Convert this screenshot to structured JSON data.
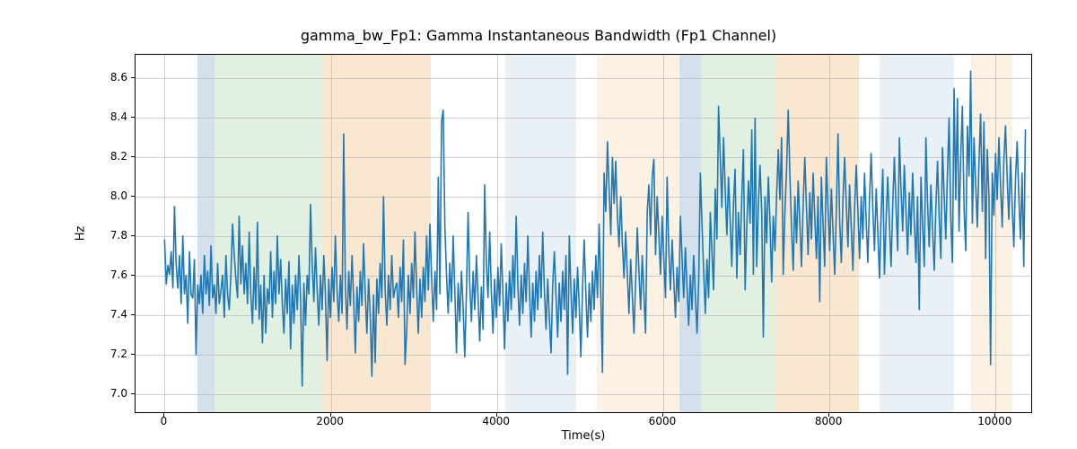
{
  "chart_data": {
    "type": "line",
    "title": "gamma_bw_Fp1: Gamma Instantaneous Bandwidth (Fp1 Channel)",
    "xlabel": "Time(s)",
    "ylabel": "Hz",
    "xlim": [
      -350,
      10450
    ],
    "ylim": [
      6.9,
      8.72
    ],
    "xticks": [
      0,
      2000,
      4000,
      6000,
      8000,
      10000
    ],
    "yticks": [
      7.0,
      7.2,
      7.4,
      7.6,
      7.8,
      8.0,
      8.2,
      8.4,
      8.6
    ],
    "grid": true,
    "bands": [
      {
        "x0": 400,
        "x1": 600,
        "color": "#b8cde0"
      },
      {
        "x0": 600,
        "x1": 1900,
        "color": "#cfe6cf"
      },
      {
        "x0": 1900,
        "x1": 3200,
        "color": "#f7d7b0"
      },
      {
        "x0": 4100,
        "x1": 4950,
        "color": "#dbe7f0"
      },
      {
        "x0": 5200,
        "x1": 6200,
        "color": "#fbe8d0"
      },
      {
        "x0": 6200,
        "x1": 6450,
        "color": "#b8cde0"
      },
      {
        "x0": 6450,
        "x1": 7350,
        "color": "#cfe6cf"
      },
      {
        "x0": 7350,
        "x1": 8350,
        "color": "#f7d7b0"
      },
      {
        "x0": 8600,
        "x1": 9500,
        "color": "#dbe7f0"
      },
      {
        "x0": 9700,
        "x1": 10200,
        "color": "#fbe8d0"
      }
    ],
    "series": [
      {
        "name": "gamma_bw_Fp1",
        "color": "#1f77b4",
        "x_start": 0,
        "x_step": 20,
        "y": [
          7.78,
          7.55,
          7.65,
          7.6,
          7.72,
          7.53,
          7.95,
          7.65,
          7.53,
          7.7,
          7.45,
          7.8,
          7.5,
          7.6,
          7.35,
          7.72,
          7.5,
          7.48,
          7.68,
          7.19,
          7.55,
          7.45,
          7.6,
          7.4,
          7.7,
          7.5,
          7.62,
          7.44,
          7.75,
          7.48,
          7.55,
          7.4,
          7.66,
          7.45,
          7.52,
          7.6,
          7.38,
          7.7,
          7.5,
          7.42,
          7.6,
          7.86,
          7.7,
          7.58,
          7.48,
          7.9,
          7.55,
          7.75,
          7.5,
          7.66,
          7.45,
          7.82,
          7.5,
          7.35,
          7.64,
          7.42,
          7.87,
          7.37,
          7.55,
          7.25,
          7.6,
          7.3,
          7.53,
          7.45,
          7.72,
          7.38,
          7.62,
          7.45,
          7.8,
          7.5,
          7.68,
          7.45,
          7.3,
          7.58,
          7.4,
          7.67,
          7.22,
          7.55,
          7.35,
          7.6,
          7.42,
          7.7,
          7.48,
          7.03,
          7.56,
          7.34,
          7.6,
          7.5,
          7.96,
          7.66,
          7.46,
          7.74,
          7.52,
          7.34,
          7.6,
          7.42,
          7.7,
          7.5,
          7.16,
          7.58,
          7.38,
          7.64,
          7.46,
          7.8,
          7.52,
          7.36,
          7.6,
          7.4,
          8.32,
          7.54,
          7.32,
          7.62,
          7.44,
          7.7,
          7.48,
          7.2,
          7.54,
          7.36,
          7.62,
          7.44,
          7.76,
          7.5,
          7.3,
          7.58,
          7.4,
          7.08,
          7.5,
          7.15,
          7.58,
          7.4,
          7.66,
          7.48,
          8.0,
          7.52,
          7.34,
          7.6,
          7.42,
          7.7,
          7.48,
          7.53,
          7.56,
          7.38,
          7.64,
          7.46,
          7.78,
          7.14,
          7.32,
          7.6,
          7.4,
          7.66,
          7.48,
          7.82,
          7.52,
          7.3,
          7.58,
          7.38,
          7.64,
          7.46,
          7.8,
          7.52,
          7.86,
          7.58,
          7.36,
          7.62,
          7.42,
          8.1,
          7.5,
          8.38,
          8.44,
          7.84,
          7.6,
          7.4,
          7.66,
          7.46,
          7.8,
          7.52,
          7.2,
          7.56,
          7.36,
          7.62,
          7.44,
          7.18,
          7.5,
          7.92,
          7.56,
          7.36,
          7.62,
          7.42,
          7.7,
          7.48,
          7.26,
          7.54,
          7.32,
          8.06,
          7.66,
          7.48,
          7.82,
          7.52,
          7.3,
          7.58,
          7.38,
          7.64,
          7.44,
          7.76,
          7.5,
          7.22,
          7.56,
          7.36,
          7.62,
          7.42,
          7.7,
          7.48,
          7.9,
          7.54,
          7.34,
          7.6,
          7.4,
          7.66,
          7.46,
          7.8,
          7.52,
          7.28,
          7.56,
          7.36,
          7.62,
          7.42,
          7.7,
          7.48,
          7.82,
          7.52,
          7.32,
          7.58,
          7.38,
          7.2,
          7.54,
          7.72,
          7.5,
          7.28,
          7.56,
          7.36,
          7.62,
          7.42,
          7.7,
          7.09,
          7.8,
          7.52,
          7.3,
          7.58,
          7.38,
          7.64,
          7.44,
          7.18,
          7.54,
          7.78,
          7.5,
          7.28,
          7.56,
          7.36,
          7.62,
          7.42,
          7.7,
          7.48,
          7.86,
          7.52,
          7.1,
          8.12,
          7.92,
          8.28,
          8.04,
          7.8,
          8.2,
          7.96,
          8.18,
          7.9,
          7.74,
          8.0,
          7.76,
          7.58,
          7.82,
          7.6,
          7.4,
          7.68,
          7.5,
          7.3,
          7.56,
          7.84,
          7.62,
          7.42,
          7.7,
          7.5,
          7.3,
          7.92,
          8.06,
          7.8,
          8.1,
          8.19,
          7.7,
          8.0,
          7.8,
          7.6,
          7.9,
          7.68,
          7.48,
          8.1,
          7.72,
          7.52,
          7.78,
          7.58,
          7.38,
          7.64,
          7.46,
          7.9,
          7.68,
          7.48,
          7.74,
          7.54,
          7.34,
          7.6,
          7.42,
          7.7,
          7.5,
          7.3,
          7.56,
          8.12,
          7.86,
          7.62,
          7.4,
          7.68,
          7.48,
          7.92,
          7.72,
          7.52,
          8.04,
          7.78,
          8.46,
          8.2,
          7.94,
          8.3,
          8.04,
          7.8,
          8.1,
          7.88,
          7.64,
          7.96,
          8.14,
          7.58,
          7.92,
          7.7,
          8.0,
          8.24,
          7.52,
          7.84,
          8.08,
          7.86,
          8.34,
          7.6,
          8.4,
          7.64,
          7.96,
          8.16,
          7.92,
          7.28,
          8.0,
          7.76,
          8.1,
          7.88,
          7.56,
          7.9,
          7.72,
          8.0,
          8.24,
          7.98,
          8.3,
          7.6,
          7.92,
          8.14,
          8.44,
          8.1,
          7.84,
          7.62,
          8.0,
          7.76,
          8.08,
          7.86,
          7.64,
          7.96,
          8.2,
          7.94,
          7.7,
          8.02,
          7.78,
          8.12,
          7.9,
          7.68,
          8.0,
          7.46,
          8.1,
          7.86,
          7.64,
          8.2,
          7.94,
          7.72,
          8.04,
          7.82,
          7.6,
          7.92,
          8.32,
          7.88,
          7.66,
          7.98,
          8.2,
          7.96,
          7.74,
          8.06,
          7.84,
          7.62,
          7.94,
          8.16,
          7.92,
          7.68,
          8.0,
          7.78,
          8.12,
          7.88,
          7.66,
          7.98,
          8.22,
          7.94,
          7.72,
          8.04,
          7.82,
          7.58,
          7.9,
          8.14,
          7.6,
          7.88,
          8.1,
          7.86,
          7.64,
          7.96,
          8.2,
          7.94,
          7.72,
          8.3,
          8.04,
          7.82,
          8.16,
          7.92,
          7.7,
          8.02,
          7.8,
          8.12,
          7.88,
          7.66,
          8.0,
          7.42,
          8.1,
          7.86,
          7.64,
          8.3,
          7.96,
          7.74,
          8.06,
          7.84,
          7.62,
          7.94,
          8.18,
          7.9,
          7.68,
          8.25,
          8.0,
          7.78,
          8.12,
          8.4,
          7.88,
          7.66,
          8.55,
          7.98,
          8.5,
          7.82,
          8.2,
          8.46,
          7.94,
          7.72,
          8.36,
          8.1,
          8.64,
          7.86,
          8.3,
          8.06,
          7.84,
          8.18,
          8.42,
          7.92,
          8.38,
          7.68,
          8.24,
          8.0,
          7.14,
          8.12,
          7.9,
          8.22,
          7.98,
          8.3,
          8.06,
          7.84,
          8.18,
          8.36,
          8.1,
          7.88,
          8.2,
          7.96,
          7.74,
          8.08,
          8.28,
          8.0,
          7.78,
          8.12,
          7.64,
          8.34
        ]
      }
    ]
  }
}
